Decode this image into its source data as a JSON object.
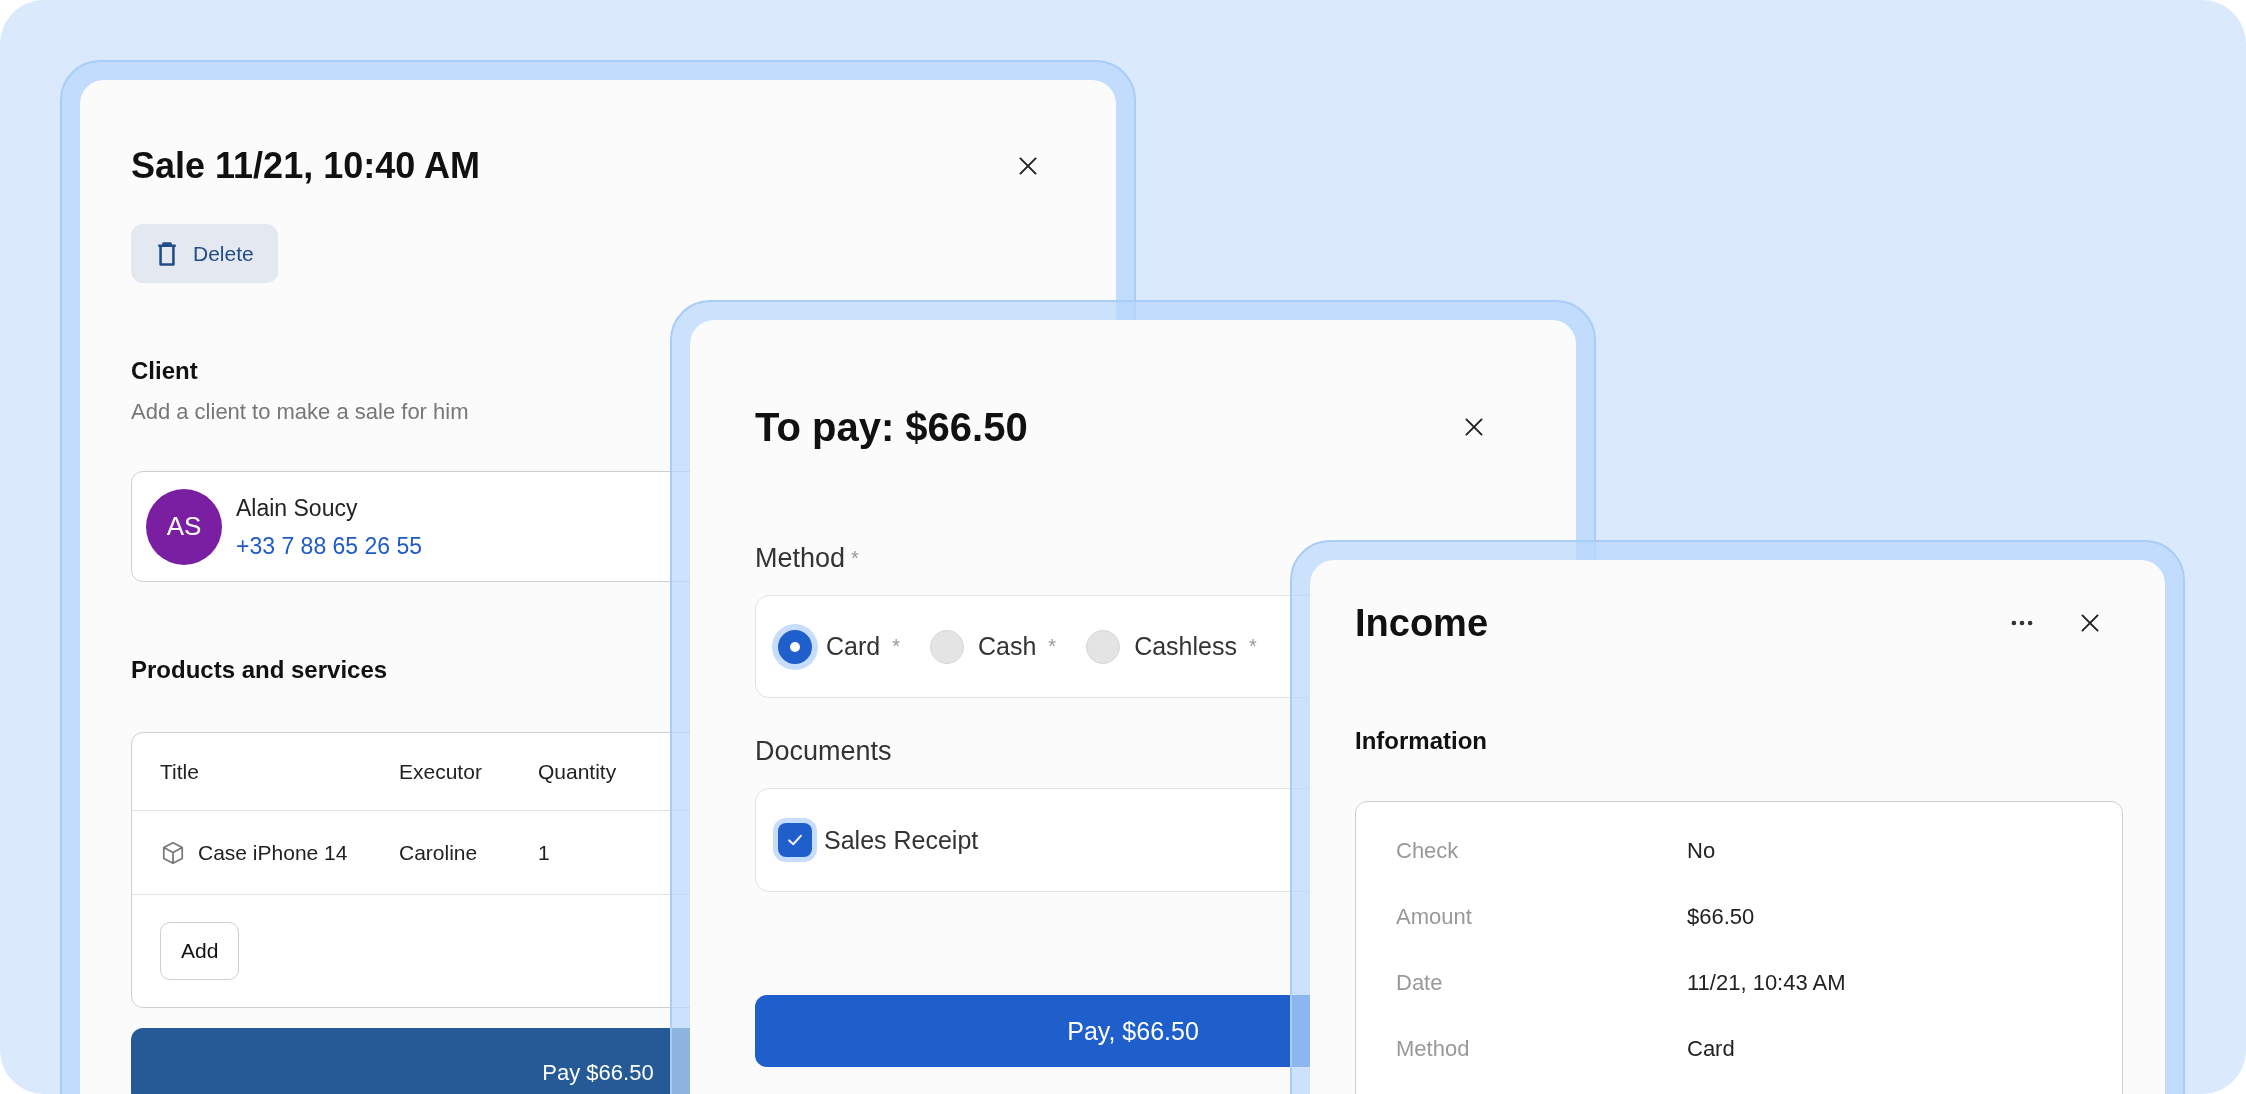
{
  "sale_window": {
    "title": "Sale 11/21, 10:40 AM",
    "delete_button": "Delete",
    "client": {
      "heading": "Client",
      "hint": "Add a client to make a sale for him",
      "initials": "AS",
      "name": "Alain Soucy",
      "phone": "+33 7 88 65 26 55"
    },
    "products": {
      "heading": "Products and services",
      "columns": [
        "Title",
        "Executor",
        "Quantity"
      ],
      "rows": [
        {
          "title": "Case iPhone 14",
          "executor": "Caroline",
          "quantity": "1"
        }
      ],
      "add_button": "Add"
    },
    "pay_button": "Pay $66.50"
  },
  "payment_window": {
    "title": "To pay: $66.50",
    "method": {
      "label": "Method",
      "mark": "*",
      "options": [
        {
          "label": "Card",
          "mark": "*",
          "selected": true
        },
        {
          "label": "Cash",
          "mark": "*",
          "selected": false
        },
        {
          "label": "Cashless",
          "mark": "*",
          "selected": false
        }
      ]
    },
    "documents": {
      "label": "Documents",
      "items": [
        {
          "label": "Sales Receipt",
          "checked": true
        }
      ]
    },
    "pay_button": "Pay, $66.50"
  },
  "income_window": {
    "title": "Income",
    "information": {
      "heading": "Information",
      "rows": [
        {
          "label": "Check",
          "value": "No"
        },
        {
          "label": "Amount",
          "value": "$66.50"
        },
        {
          "label": "Date",
          "value": "11/21, 10:43 AM"
        },
        {
          "label": "Method",
          "value": "Card"
        }
      ]
    }
  }
}
